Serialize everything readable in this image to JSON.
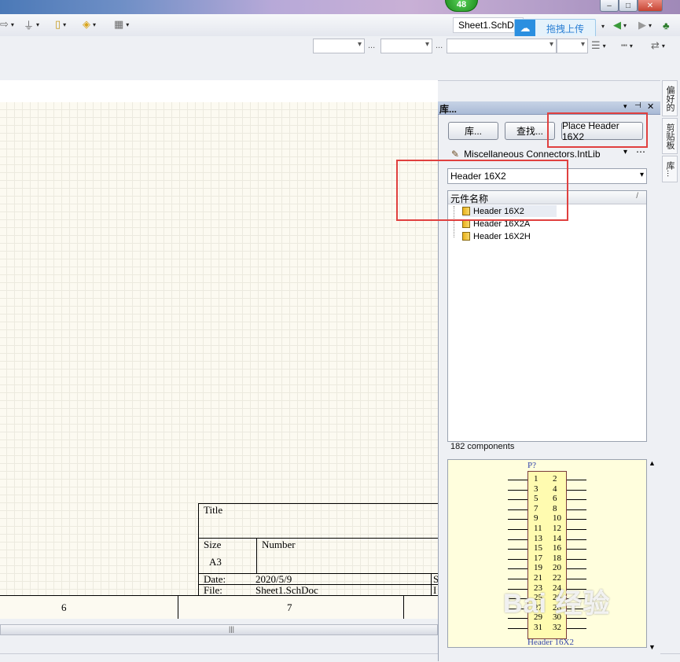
{
  "titlebar": {
    "badge": "48",
    "min": "–",
    "max": "□",
    "close": "✕"
  },
  "toolbar": {
    "sheet_tab": "Sheet1.SchDoc",
    "upload_label": "拖拽上传",
    "dots": "..."
  },
  "right_tabs": [
    "偏好的",
    "剪贴板",
    "库..."
  ],
  "title_block": {
    "title_label": "Title",
    "size_label": "Size",
    "size_value": "A3",
    "number_label": "Number",
    "date_label": "Date:",
    "date_value": "2020/5/9",
    "file_label": "File:",
    "file_value": "Sheet1.SchDoc",
    "sheet_cut": "S",
    "drawn_cut": "I"
  },
  "zones": [
    "6",
    "7"
  ],
  "scroll_grip": "|||",
  "library_panel": {
    "title": "库...",
    "btn_library": "库...",
    "btn_search": "查找...",
    "btn_place": "Place Header 16X2",
    "library_name": "Miscellaneous Connectors.IntLib",
    "filter_value": "Header 16X2",
    "list_header": "元件名称",
    "sort_marker": "/",
    "items": [
      "Header 16X2",
      "Header 16X2A",
      "Header 16X2H"
    ],
    "component_count": "182 components",
    "preview": {
      "designator": "P?",
      "name": "Header 16X2",
      "pins_left": [
        "1",
        "3",
        "5",
        "7",
        "9",
        "11",
        "13",
        "15",
        "17",
        "19",
        "21",
        "23",
        "25",
        "27",
        "29",
        "31"
      ],
      "pins_right": [
        "2",
        "4",
        "6",
        "8",
        "10",
        "12",
        "14",
        "16",
        "18",
        "20",
        "22",
        "24",
        "26",
        "28",
        "30",
        "32"
      ]
    }
  },
  "watermark": "Bai 经验"
}
